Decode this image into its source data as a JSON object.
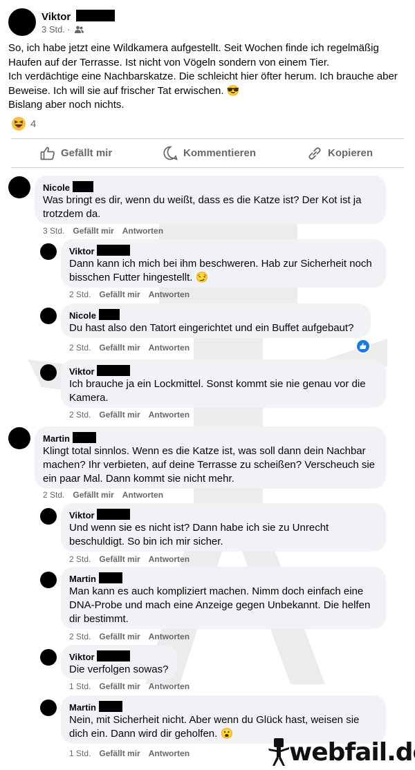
{
  "post": {
    "author": "Viktor",
    "time": "3 Std.",
    "audience_icon": "friends-icon",
    "text_lines": [
      "So, ich habe jetzt eine Wildkamera aufgestellt. Seit Wochen finde ich regelmäßig Haufen auf der Terrasse. Ist nicht von Vögeln sondern von einem Tier.",
      "Ich verdächtige eine Nachbarskatze. Die schleicht hier öfter herum. Ich brauche aber Beweise. Ich will sie auf frischer Tat erwischen. 😎",
      "Bislang aber noch nichts."
    ],
    "reaction_count": "4"
  },
  "actions": {
    "like": "Gefällt mir",
    "comment": "Kommentieren",
    "copy": "Kopieren"
  },
  "comments": [
    {
      "author": "Nicole",
      "text": "Was bringt es dir, wenn du weißt, dass es die Katze ist? Der Kot ist ja trotzdem da.",
      "time": "3 Std.",
      "like": "Gefällt mir",
      "reply": "Antworten"
    },
    {
      "author": "Viktor",
      "text": "Dann kann ich mich bei ihm beschweren. Hab zur Sicherheit noch bisschen Futter hingestellt. 😏",
      "time": "2 Std.",
      "like": "Gefällt mir",
      "reply": "Antworten"
    },
    {
      "author": "Nicole",
      "text": "Du hast also den Tatort eingerichtet und ein Buffet aufgebaut?",
      "time": "2 Std.",
      "like": "Gefällt mir",
      "reply": "Antworten"
    },
    {
      "author": "Viktor",
      "text": "Ich brauche ja ein Lockmittel. Sonst kommt sie nie genau vor die Kamera.",
      "time": "2 Std.",
      "like": "Gefällt mir",
      "reply": "Antworten"
    },
    {
      "author": "Martin",
      "text": "Klingt total sinnlos. Wenn es die Katze ist, was soll dann dein Nachbar machen? Ihr verbieten, auf deine Terrasse zu scheißen? Verscheuch sie ein paar Mal. Dann kommt sie nicht mehr.",
      "time": "2 Std.",
      "like": "Gefällt mir",
      "reply": "Antworten"
    },
    {
      "author": "Viktor",
      "text": "Und wenn sie es nicht ist? Dann habe ich sie zu Unrecht beschuldigt. So bin ich mir sicher.",
      "time": "2 Std.",
      "like": "Gefällt mir",
      "reply": "Antworten"
    },
    {
      "author": "Martin",
      "text": "Man kann es auch kompliziert machen. Nimm doch einfach eine DNA-Probe und mach eine Anzeige gegen Unbekannt. Die helfen dir bestimmt.",
      "time": "2 Std.",
      "like": "Gefällt mir",
      "reply": "Antworten"
    },
    {
      "author": "Viktor",
      "text": "Die verfolgen sowas?",
      "time": "1 Std.",
      "like": "Gefällt mir",
      "reply": "Antworten"
    },
    {
      "author": "Martin",
      "text": "Nein, mit Sicherheit nicht. Aber wenn du Glück hast, weisen sie dich ein. Dann wird dir geholfen. 😮",
      "time": "1 Std.",
      "like": "Gefällt mir",
      "reply": "Antworten"
    }
  ],
  "logo": {
    "text": "webfail.de"
  },
  "colors": {
    "bubble": "#f0f2f5",
    "meta": "#65676b",
    "like_blue": "#1877f2"
  }
}
